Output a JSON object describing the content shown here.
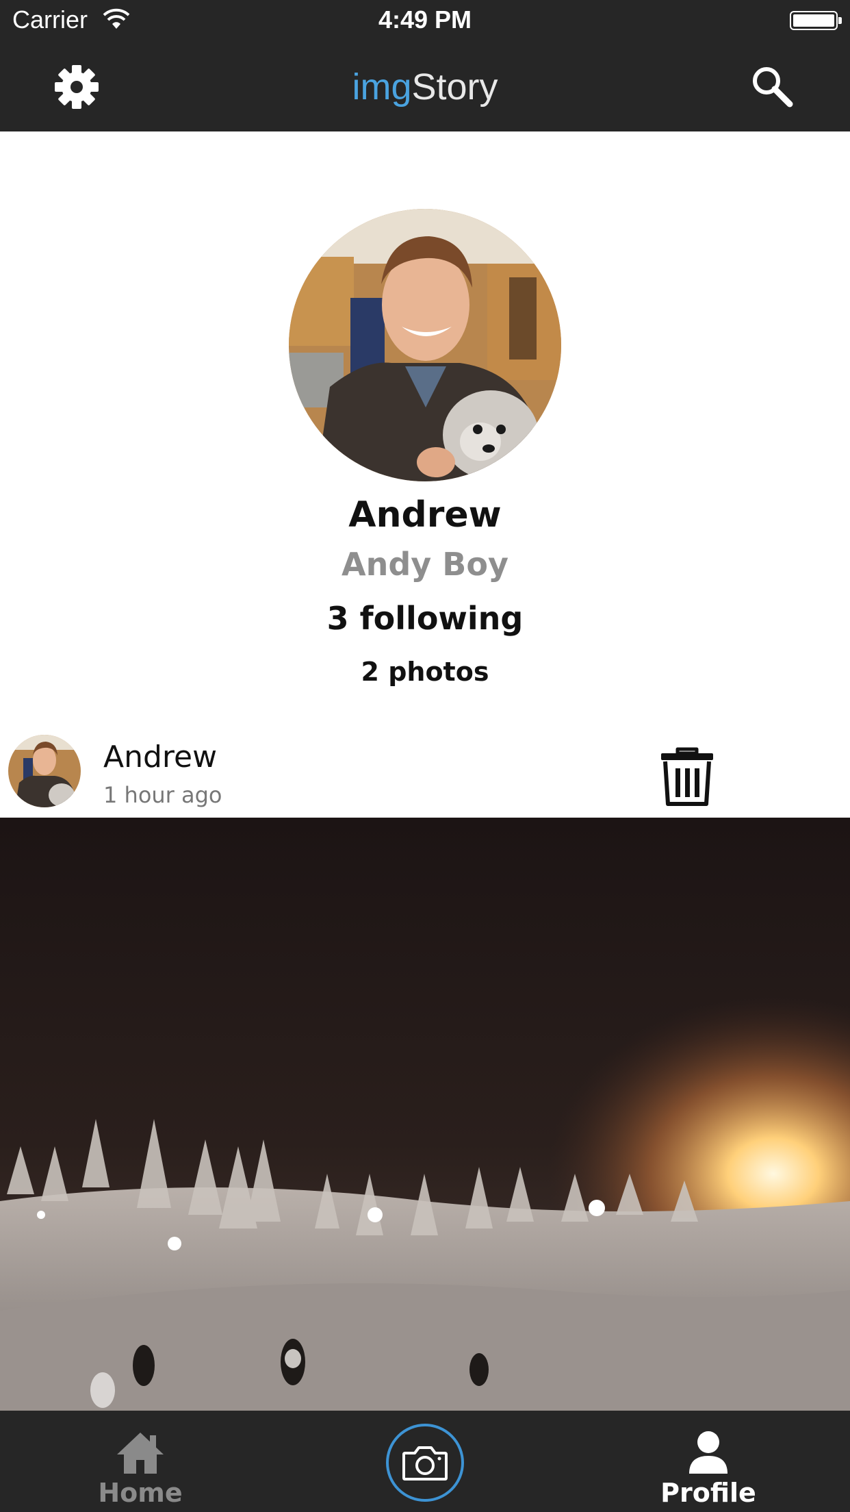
{
  "status_bar": {
    "carrier": "Carrier",
    "time": "4:49 PM"
  },
  "nav": {
    "title_prefix": "img",
    "title_suffix": "Story",
    "left_icon": "gear-icon",
    "right_icon": "search-icon",
    "accent_color": "#4aa3e0"
  },
  "profile": {
    "name": "Andrew",
    "username": "Andy Boy",
    "following": "3 following",
    "photos": "2 photos"
  },
  "post": {
    "author": "Andrew",
    "time_ago": "1 hour ago",
    "action_icon": "trash-icon"
  },
  "tabs": [
    {
      "label": "Home",
      "icon": "home-icon",
      "active": false
    },
    {
      "label": "",
      "icon": "camera-icon",
      "active": false
    },
    {
      "label": "Profile",
      "icon": "person-icon",
      "active": true
    }
  ],
  "colors": {
    "bar_background": "#262626",
    "camera_ring": "#3d93d4"
  }
}
